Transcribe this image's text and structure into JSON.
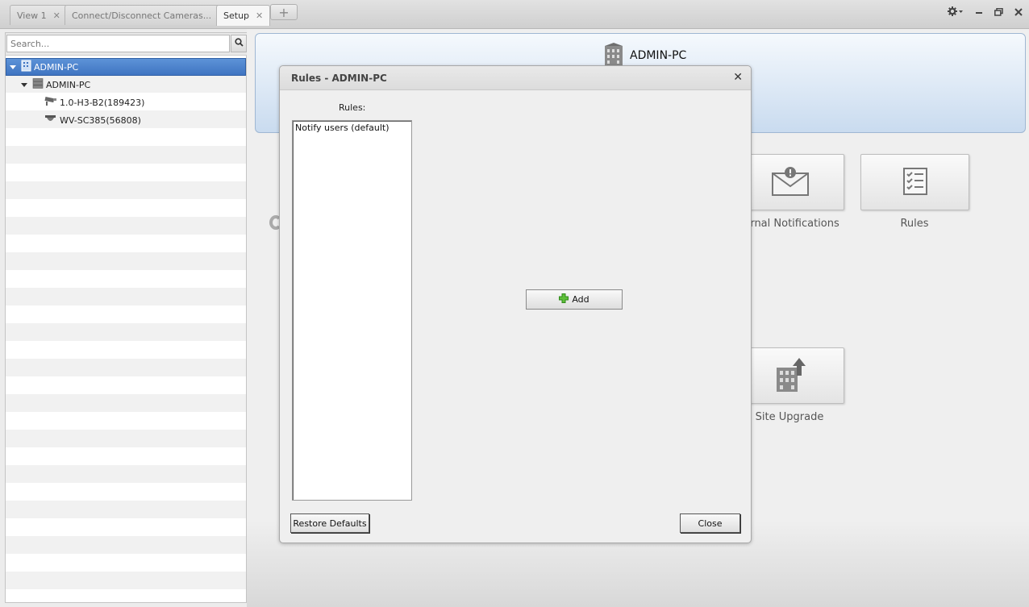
{
  "tabs": [
    {
      "label": "View 1",
      "close": "✕"
    },
    {
      "label": "Connect/Disconnect Cameras...",
      "close": "✕"
    },
    {
      "label": "Setup",
      "close": "✕"
    }
  ],
  "tab_add_label": "+",
  "search": {
    "placeholder": "Search..."
  },
  "tree": {
    "root": "ADMIN-PC",
    "server": "ADMIN-PC",
    "cameras": [
      "1.0-H3-B2(189423)",
      "WV-SC385(56808)"
    ]
  },
  "header": {
    "title": "ADMIN-PC"
  },
  "tiles": {
    "notifications": "ternal Notifications",
    "rules": "Rules",
    "site_upgrade": "Site Upgrade"
  },
  "dialog": {
    "title": "Rules - ADMIN-PC",
    "close_glyph": "✕",
    "rules_label": "Rules:",
    "rules": [
      "Notify users (default)"
    ],
    "add_label": "Add",
    "restore_label": "Restore Defaults",
    "close_label": "Close"
  },
  "icons": [
    "gear-icon",
    "minimize-icon",
    "restore-icon",
    "close-icon",
    "search-icon",
    "server-icon",
    "camera-icon",
    "envelope-icon",
    "checklist-icon",
    "building-upload-icon",
    "plus-icon"
  ]
}
